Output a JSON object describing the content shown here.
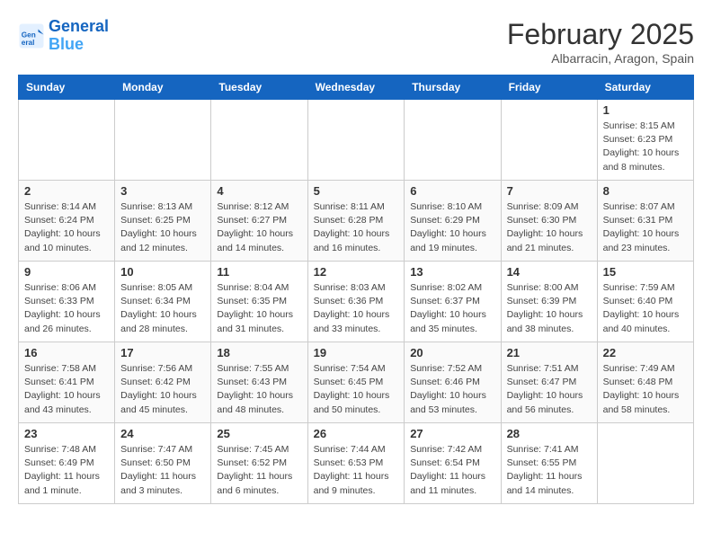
{
  "logo": {
    "line1": "General",
    "line2": "Blue"
  },
  "title": "February 2025",
  "subtitle": "Albarracin, Aragon, Spain",
  "weekdays": [
    "Sunday",
    "Monday",
    "Tuesday",
    "Wednesday",
    "Thursday",
    "Friday",
    "Saturday"
  ],
  "weeks": [
    [
      {
        "day": "",
        "info": ""
      },
      {
        "day": "",
        "info": ""
      },
      {
        "day": "",
        "info": ""
      },
      {
        "day": "",
        "info": ""
      },
      {
        "day": "",
        "info": ""
      },
      {
        "day": "",
        "info": ""
      },
      {
        "day": "1",
        "info": "Sunrise: 8:15 AM\nSunset: 6:23 PM\nDaylight: 10 hours\nand 8 minutes."
      }
    ],
    [
      {
        "day": "2",
        "info": "Sunrise: 8:14 AM\nSunset: 6:24 PM\nDaylight: 10 hours\nand 10 minutes."
      },
      {
        "day": "3",
        "info": "Sunrise: 8:13 AM\nSunset: 6:25 PM\nDaylight: 10 hours\nand 12 minutes."
      },
      {
        "day": "4",
        "info": "Sunrise: 8:12 AM\nSunset: 6:27 PM\nDaylight: 10 hours\nand 14 minutes."
      },
      {
        "day": "5",
        "info": "Sunrise: 8:11 AM\nSunset: 6:28 PM\nDaylight: 10 hours\nand 16 minutes."
      },
      {
        "day": "6",
        "info": "Sunrise: 8:10 AM\nSunset: 6:29 PM\nDaylight: 10 hours\nand 19 minutes."
      },
      {
        "day": "7",
        "info": "Sunrise: 8:09 AM\nSunset: 6:30 PM\nDaylight: 10 hours\nand 21 minutes."
      },
      {
        "day": "8",
        "info": "Sunrise: 8:07 AM\nSunset: 6:31 PM\nDaylight: 10 hours\nand 23 minutes."
      }
    ],
    [
      {
        "day": "9",
        "info": "Sunrise: 8:06 AM\nSunset: 6:33 PM\nDaylight: 10 hours\nand 26 minutes."
      },
      {
        "day": "10",
        "info": "Sunrise: 8:05 AM\nSunset: 6:34 PM\nDaylight: 10 hours\nand 28 minutes."
      },
      {
        "day": "11",
        "info": "Sunrise: 8:04 AM\nSunset: 6:35 PM\nDaylight: 10 hours\nand 31 minutes."
      },
      {
        "day": "12",
        "info": "Sunrise: 8:03 AM\nSunset: 6:36 PM\nDaylight: 10 hours\nand 33 minutes."
      },
      {
        "day": "13",
        "info": "Sunrise: 8:02 AM\nSunset: 6:37 PM\nDaylight: 10 hours\nand 35 minutes."
      },
      {
        "day": "14",
        "info": "Sunrise: 8:00 AM\nSunset: 6:39 PM\nDaylight: 10 hours\nand 38 minutes."
      },
      {
        "day": "15",
        "info": "Sunrise: 7:59 AM\nSunset: 6:40 PM\nDaylight: 10 hours\nand 40 minutes."
      }
    ],
    [
      {
        "day": "16",
        "info": "Sunrise: 7:58 AM\nSunset: 6:41 PM\nDaylight: 10 hours\nand 43 minutes."
      },
      {
        "day": "17",
        "info": "Sunrise: 7:56 AM\nSunset: 6:42 PM\nDaylight: 10 hours\nand 45 minutes."
      },
      {
        "day": "18",
        "info": "Sunrise: 7:55 AM\nSunset: 6:43 PM\nDaylight: 10 hours\nand 48 minutes."
      },
      {
        "day": "19",
        "info": "Sunrise: 7:54 AM\nSunset: 6:45 PM\nDaylight: 10 hours\nand 50 minutes."
      },
      {
        "day": "20",
        "info": "Sunrise: 7:52 AM\nSunset: 6:46 PM\nDaylight: 10 hours\nand 53 minutes."
      },
      {
        "day": "21",
        "info": "Sunrise: 7:51 AM\nSunset: 6:47 PM\nDaylight: 10 hours\nand 56 minutes."
      },
      {
        "day": "22",
        "info": "Sunrise: 7:49 AM\nSunset: 6:48 PM\nDaylight: 10 hours\nand 58 minutes."
      }
    ],
    [
      {
        "day": "23",
        "info": "Sunrise: 7:48 AM\nSunset: 6:49 PM\nDaylight: 11 hours\nand 1 minute."
      },
      {
        "day": "24",
        "info": "Sunrise: 7:47 AM\nSunset: 6:50 PM\nDaylight: 11 hours\nand 3 minutes."
      },
      {
        "day": "25",
        "info": "Sunrise: 7:45 AM\nSunset: 6:52 PM\nDaylight: 11 hours\nand 6 minutes."
      },
      {
        "day": "26",
        "info": "Sunrise: 7:44 AM\nSunset: 6:53 PM\nDaylight: 11 hours\nand 9 minutes."
      },
      {
        "day": "27",
        "info": "Sunrise: 7:42 AM\nSunset: 6:54 PM\nDaylight: 11 hours\nand 11 minutes."
      },
      {
        "day": "28",
        "info": "Sunrise: 7:41 AM\nSunset: 6:55 PM\nDaylight: 11 hours\nand 14 minutes."
      },
      {
        "day": "",
        "info": ""
      }
    ]
  ]
}
